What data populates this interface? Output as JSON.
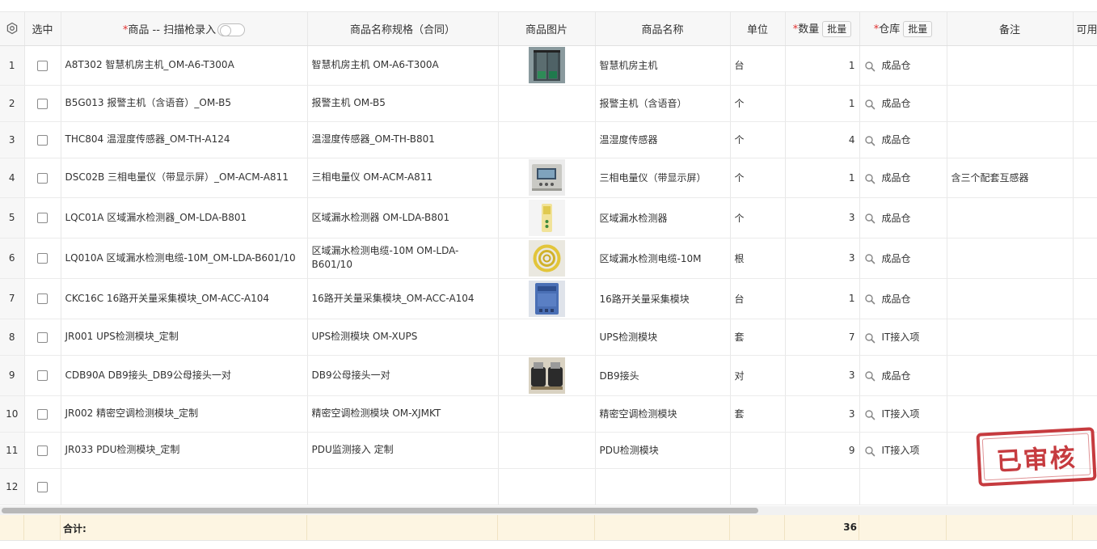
{
  "header": {
    "select_label": "选中",
    "product_label": "商品 -- 扫描枪录入",
    "spec_label": "商品名称规格（合同）",
    "image_label": "商品图片",
    "name_label": "商品名称",
    "unit_label": "单位",
    "qty_label": "数量",
    "warehouse_label": "仓库",
    "batch_label": "批量",
    "remark_label": "备注",
    "available_label": "可用",
    "required_mark": "*"
  },
  "rows": [
    {
      "idx": "1",
      "product": "A8T302 智慧机房主机_OM-A6-T300A",
      "spec": "智慧机房主机 OM-A6-T300A",
      "name": "智慧机房主机",
      "unit": "台",
      "qty": "1",
      "warehouse": "成品仓",
      "remark": "",
      "image": "rack-photo"
    },
    {
      "idx": "2",
      "product": "B5G013 报警主机（含语音）_OM-B5",
      "spec": "报警主机 OM-B5",
      "name": "报警主机（含语音）",
      "unit": "个",
      "qty": "1",
      "warehouse": "成品仓",
      "remark": "",
      "image": ""
    },
    {
      "idx": "3",
      "product": "THC804 温湿度传感器_OM-TH-A124",
      "spec": "温湿度传感器_OM-TH-B801",
      "name": "温湿度传感器",
      "unit": "个",
      "qty": "4",
      "warehouse": "成品仓",
      "remark": "",
      "image": ""
    },
    {
      "idx": "4",
      "product": "DSC02B 三相电量仪（带显示屏）_OM-ACM-A811",
      "spec": "三相电量仪 OM-ACM-A811",
      "name": "三相电量仪（带显示屏）",
      "unit": "个",
      "qty": "1",
      "warehouse": "成品仓",
      "remark": "含三个配套互感器",
      "image": "meter-photo"
    },
    {
      "idx": "5",
      "product": "LQC01A 区域漏水检测器_OM-LDA-B801",
      "spec": "区域漏水检测器 OM-LDA-B801",
      "name": "区域漏水检测器",
      "unit": "个",
      "qty": "3",
      "warehouse": "成品仓",
      "remark": "",
      "image": "detector-photo"
    },
    {
      "idx": "6",
      "product": "LQ010A 区域漏水检测电缆-10M_OM-LDA-B601/10",
      "spec": "区域漏水检测电缆-10M OM-LDA-B601/10",
      "name": "区域漏水检测电缆-10M",
      "unit": "根",
      "qty": "3",
      "warehouse": "成品仓",
      "remark": "",
      "image": "cable-photo"
    },
    {
      "idx": "7",
      "product": "CKC16C 16路开关量采集模块_OM-ACC-A104",
      "spec": "16路开关量采集模块_OM-ACC-A104",
      "name": "16路开关量采集模块",
      "unit": "台",
      "qty": "1",
      "warehouse": "成品仓",
      "remark": "",
      "image": "module-photo"
    },
    {
      "idx": "8",
      "product": "JR001 UPS检测模块_定制",
      "spec": "UPS检测模块 OM-XUPS",
      "name": "UPS检测模块",
      "unit": "套",
      "qty": "7",
      "warehouse": "IT接入项",
      "remark": "",
      "image": ""
    },
    {
      "idx": "9",
      "product": "CDB90A DB9接头_DB9公母接头一对",
      "spec": "DB9公母接头一对",
      "name": "DB9接头",
      "unit": "对",
      "qty": "3",
      "warehouse": "成品仓",
      "remark": "",
      "image": "db9-photo"
    },
    {
      "idx": "10",
      "product": "JR002 精密空调检测模块_定制",
      "spec": "精密空调检测模块 OM-XJMKT",
      "name": "精密空调检测模块",
      "unit": "套",
      "qty": "3",
      "warehouse": "IT接入项",
      "remark": "",
      "image": ""
    },
    {
      "idx": "11",
      "product": "JR033 PDU检测模块_定制",
      "spec": "PDU监测接入 定制",
      "name": "PDU检测模块",
      "unit": "",
      "qty": "9",
      "warehouse": "IT接入项",
      "remark": "",
      "image": ""
    },
    {
      "idx": "12",
      "product": "",
      "spec": "",
      "name": "",
      "unit": "",
      "qty": "",
      "warehouse": "",
      "remark": "",
      "image": "",
      "empty": true
    }
  ],
  "footer": {
    "total_label": "合计:",
    "total_qty": "36"
  },
  "stamp": {
    "text": "已审核",
    "color": "#c0262b"
  },
  "colors": {
    "required": "#e0302f",
    "footer_bg": "#fdf5e2",
    "header_bg": "#f7f7f7"
  }
}
